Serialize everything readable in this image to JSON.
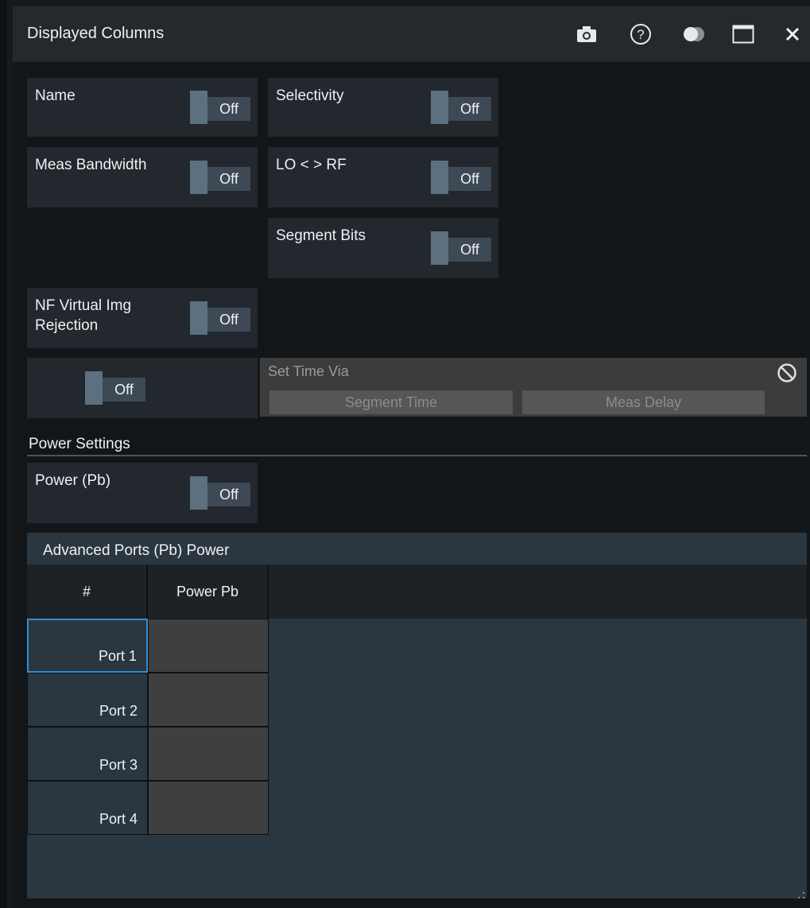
{
  "window": {
    "title": "Displayed Columns"
  },
  "toolbar_icons": [
    "camera-icon",
    "help-icon",
    "toggle-theme-icon",
    "maximize-icon",
    "close-icon"
  ],
  "toggles": {
    "name": {
      "label": "Name",
      "state": "Off"
    },
    "selectivity": {
      "label": "Selectivity",
      "state": "Off"
    },
    "meas_bandwidth": {
      "label": "Meas Bandwidth",
      "state": "Off"
    },
    "lo_rf": {
      "label": "LO < > RF",
      "state": "Off"
    },
    "segment_bits": {
      "label": "Segment Bits",
      "state": "Off"
    },
    "nf_virtual_img_line1": "NF Virtual Img",
    "nf_virtual_img_line2": "Rejection",
    "nf_virtual_img_state": "Off",
    "time_toggle_state": "Off"
  },
  "set_time": {
    "label": "Set Time Via",
    "options": [
      "Segment Time",
      "Meas Delay"
    ]
  },
  "power_settings": {
    "section_title": "Power Settings",
    "power_pb": {
      "label": "Power (Pb)",
      "state": "Off"
    }
  },
  "advanced_ports": {
    "title": "Advanced Ports (Pb) Power",
    "columns": [
      "#",
      "Power Pb"
    ],
    "rows": [
      {
        "port": "Port 1",
        "power": ""
      },
      {
        "port": "Port 2",
        "power": ""
      },
      {
        "port": "Port 3",
        "power": ""
      },
      {
        "port": "Port 4",
        "power": ""
      }
    ]
  },
  "colors": {
    "accent": "#2f8fd6",
    "toggle_knob": "#5c7080",
    "toggle_state_bg": "#3d4a55"
  }
}
